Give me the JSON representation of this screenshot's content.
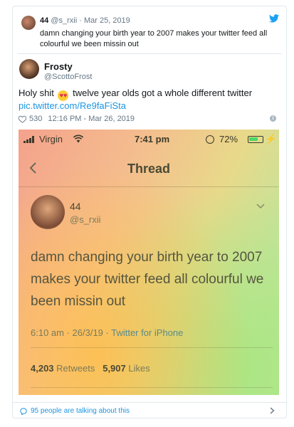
{
  "quoted": {
    "name": "44",
    "handle": "@s_rxii",
    "date": "Mar 25, 2019",
    "text": "damn changing your birth year to 2007 makes your twitter feed all colourful we been missin out"
  },
  "tweet": {
    "name": "Frosty",
    "handle": "@ScottoFrost",
    "text_before": "Holy shit",
    "text_after": "twelve year olds got a whole different twitter",
    "link": "pic.twitter.com/Re9faFiSta",
    "likes": "530",
    "timestamp": "12:16 PM - Mar 26, 2019"
  },
  "screenshot": {
    "carrier": "Virgin",
    "time": "7:41 pm",
    "battery": "72%",
    "battery_level": 0.72,
    "title": "Thread",
    "name": "44",
    "handle": "@s_rxii",
    "body": "damn changing your birth year to 2007 makes your twitter feed all colourful we been missin out",
    "time_line": "6:10 am · 26/3/19 · ",
    "source": "Twitter for iPhone",
    "retweets_count": "4,203",
    "retweets_label": "Retweets",
    "likes_count": "5,907",
    "likes_label": "Likes"
  },
  "footer": {
    "talking": "95 people are talking about this"
  },
  "colors": {
    "twitter_blue": "#1b95e0",
    "heart_gray": "#657786"
  }
}
